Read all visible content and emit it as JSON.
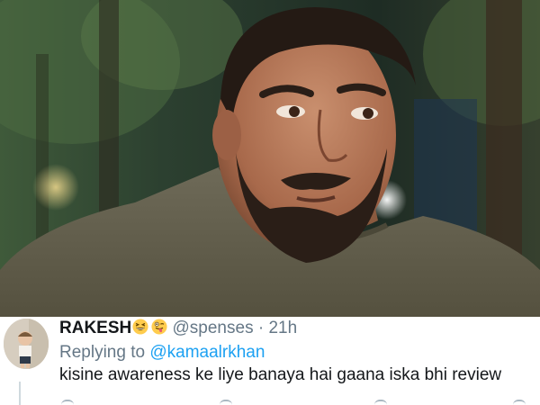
{
  "photo": {
    "subject": "man-portrait-icon"
  },
  "tweet": {
    "display_name": "RAKESH",
    "emojis": [
      "grinning-squinting-face-icon",
      "winking-face-tongue-icon"
    ],
    "handle": "@spenses",
    "separator": "·",
    "time": "21h",
    "replying_prefix": "Replying to ",
    "replying_to": "@kamaalrkhan",
    "text": "kisine awareness ke liye banaya hai gaana iska bhi review"
  },
  "colors": {
    "link": "#1da1f2",
    "secondary_text": "#657786",
    "primary_text": "#14171a"
  }
}
